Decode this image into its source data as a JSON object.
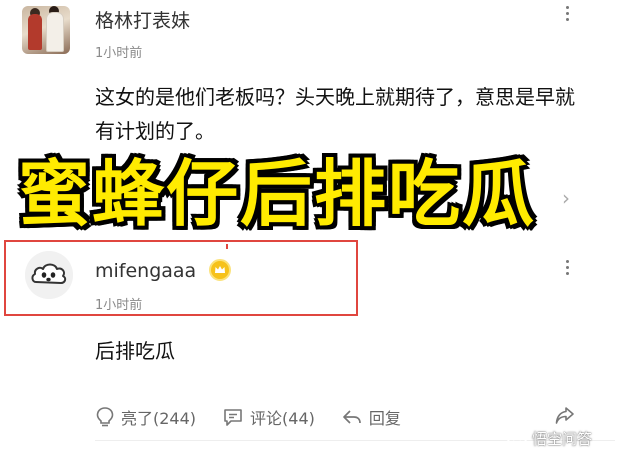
{
  "comment1": {
    "username": "格林打表妹",
    "time": "1小时前",
    "text": "这女的是他们老板吗？头天晚上就期待了，意思是早就有计划的了。"
  },
  "overlay": {
    "caption": "蜜蜂仔后排吃瓜"
  },
  "comment2": {
    "username": "mifengaaa",
    "time": "1小时前",
    "text": "后排吃瓜",
    "badge_icon": "crown-badge-icon"
  },
  "actions": {
    "like_label": "亮了(244)",
    "comment_label": "评论(44)",
    "reply_label": "回复",
    "share_icon": "share-icon"
  },
  "watermark": {
    "text": "悟空问答"
  },
  "colors": {
    "highlight_border": "#e0463f",
    "caption_fill": "#ffeb00",
    "badge": "#f6c21b"
  }
}
